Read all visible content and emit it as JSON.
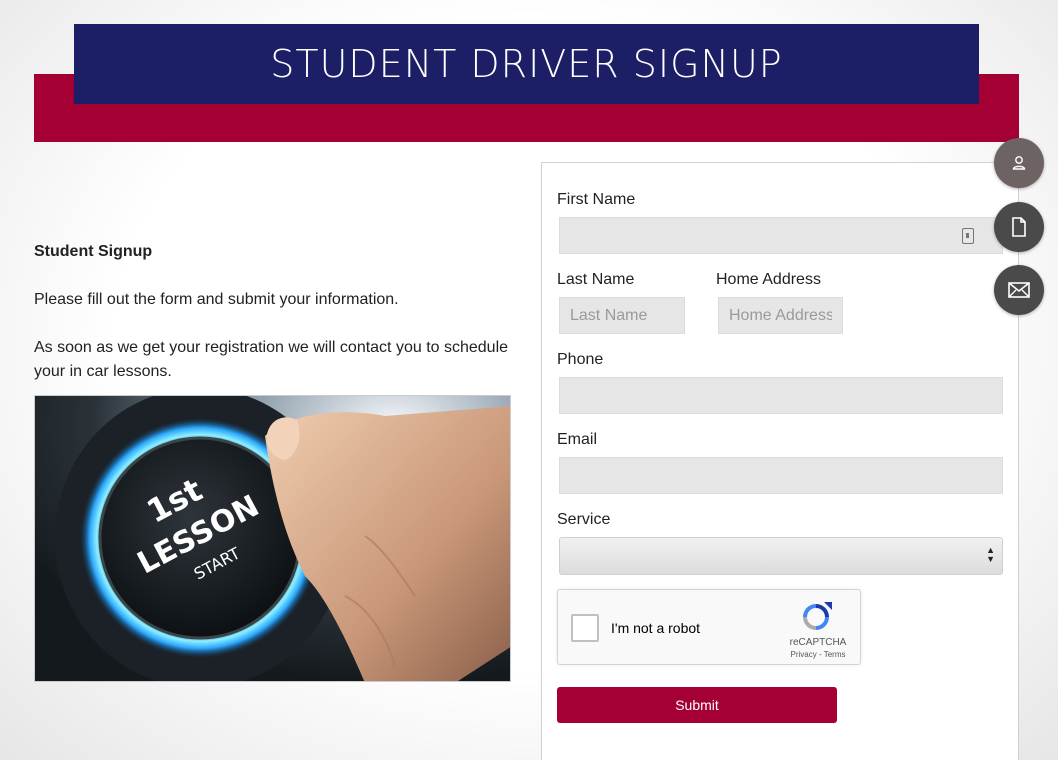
{
  "header": {
    "title": "STUDENT DRIVER SIGNUP"
  },
  "intro": {
    "heading": "Student Signup",
    "paragraph_1": "Please fill out the form and submit your information.",
    "paragraph_2": "As soon as we get your registration we will contact you to schedule your in car lessons."
  },
  "hero_image": {
    "button_text_line1": "1st",
    "button_text_line2": "LESSON",
    "button_text_line3": "START"
  },
  "form": {
    "first_name": {
      "label": "First Name",
      "value": "",
      "placeholder": ""
    },
    "last_name": {
      "label": "Last Name",
      "value": "",
      "placeholder": "Last Name"
    },
    "home_address": {
      "label": "Home Address",
      "value": "",
      "placeholder": "Home Address"
    },
    "phone": {
      "label": "Phone",
      "value": "",
      "placeholder": ""
    },
    "email": {
      "label": "Email",
      "value": "",
      "placeholder": ""
    },
    "service": {
      "label": "Service",
      "selected": ""
    },
    "recaptcha": {
      "label": "I'm not a robot",
      "brand": "reCAPTCHA",
      "links": "Privacy - Terms"
    },
    "submit_label": "Submit"
  },
  "side_actions": [
    {
      "icon": "user-icon",
      "color": "#6e6363"
    },
    {
      "icon": "document-icon",
      "color": "#4a4a4a"
    },
    {
      "icon": "mail-icon",
      "color": "#4a4a4a"
    }
  ],
  "colors": {
    "navy": "#1c1f66",
    "crimson": "#a50034",
    "field_bg": "#e6e6e6"
  }
}
